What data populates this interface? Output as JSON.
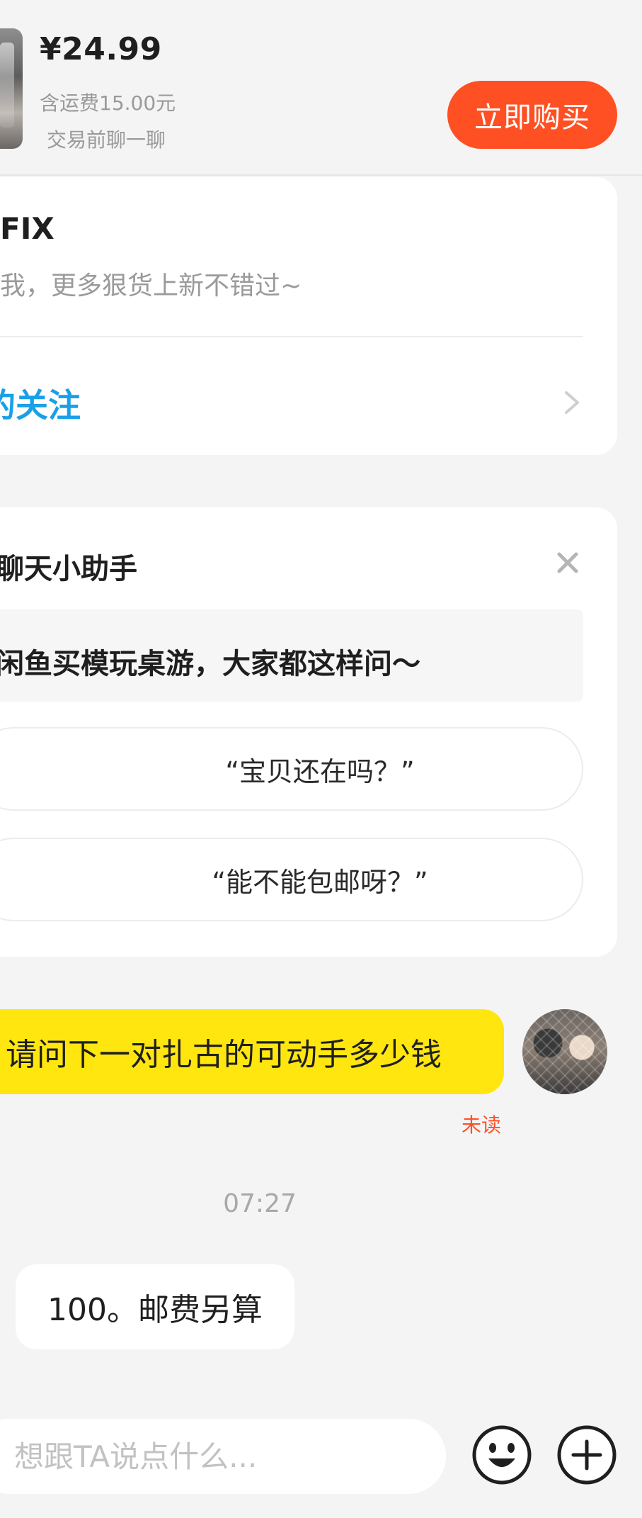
{
  "product": {
    "price": "¥24.99",
    "shipping": "含运费15.00元",
    "pre_chat": "交易前聊一聊",
    "buy_label": "立即购买"
  },
  "follow_card": {
    "name": "FIX",
    "desc": "我，更多狠货上新不错过~",
    "action": "的关注"
  },
  "assistant": {
    "title": "聊天小助手",
    "banner": "闲鱼买模玩桌游，大家都这样问～",
    "questions": [
      "“宝贝还在吗？”",
      "“能不能包邮呀？”"
    ]
  },
  "messages": {
    "outgoing": "请问下一对扎古的可动手多少钱",
    "unread": "未读",
    "timestamp": "07:27",
    "incoming": "100。邮费另算"
  },
  "input": {
    "placeholder": "想跟TA说点什么..."
  },
  "colors": {
    "accent": "#ff5023",
    "bubble_self": "#ffe60f",
    "link_blue": "#19a0e8",
    "background": "#f4f4f5"
  },
  "icons": [
    "chevron-right-icon",
    "close-icon",
    "emoji-icon",
    "plus-icon"
  ]
}
